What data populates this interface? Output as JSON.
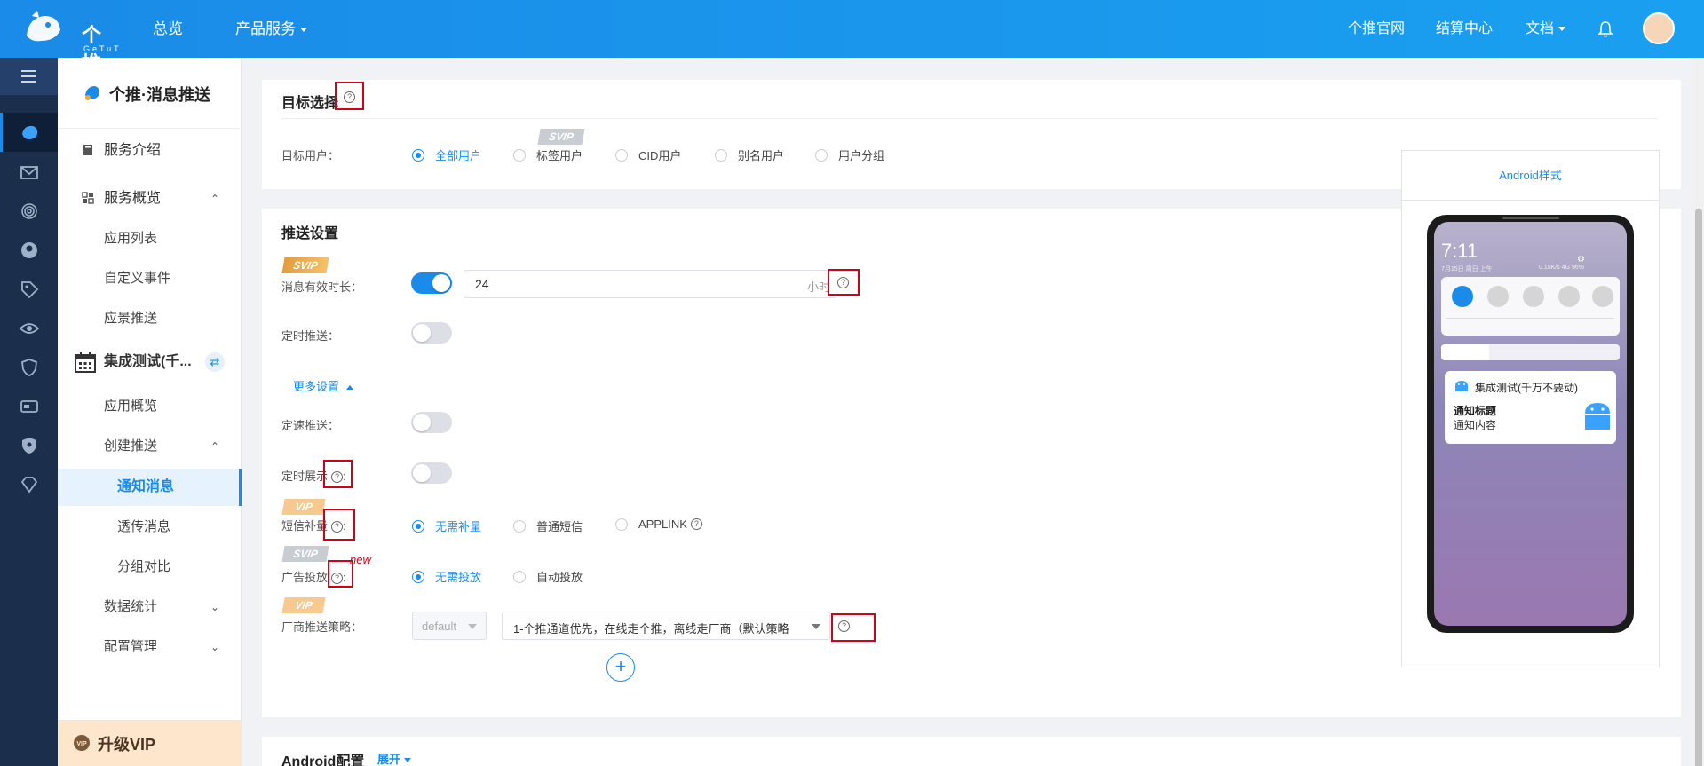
{
  "topbar": {
    "logo_text": "个推",
    "logo_sub": "GeTuT",
    "nav": [
      {
        "label": "总览"
      },
      {
        "label": "产品服务"
      }
    ],
    "right_nav": [
      {
        "label": "个推官网"
      },
      {
        "label": "结算中心"
      },
      {
        "label": "文档"
      }
    ]
  },
  "sidebar": {
    "product_title": "个推·消息推送",
    "items": [
      {
        "label": "服务介绍"
      },
      {
        "label": "服务概览"
      },
      {
        "label": "应用列表"
      },
      {
        "label": "自定义事件"
      },
      {
        "label": "应景推送"
      },
      {
        "label": "集成测试(千..."
      },
      {
        "label": "应用概览"
      },
      {
        "label": "创建推送"
      },
      {
        "label": "通知消息"
      },
      {
        "label": "透传消息"
      },
      {
        "label": "分组对比"
      },
      {
        "label": "数据统计"
      },
      {
        "label": "配置管理"
      }
    ],
    "upgrade_label": "升级VIP"
  },
  "target": {
    "title": "目标选择",
    "user_label": "目标用户：",
    "svip_badge": "SVIP",
    "options": [
      "全部用户",
      "标签用户",
      "CID用户",
      "别名用户",
      "用户分组"
    ],
    "selected": "全部用户"
  },
  "push": {
    "title": "推送设置",
    "svip_badge": "SVIP",
    "vip_badge": "VIP",
    "validity_label": "消息有效时长：",
    "validity_value": "24",
    "validity_unit": "小时",
    "scheduled_label": "定时推送：",
    "more_settings": "更多设置",
    "rate_label": "定速推送：",
    "timed_display_label": "定时展示",
    "sms_label": "短信补量",
    "sms_options": [
      "无需补量",
      "普通短信",
      "APPLINK"
    ],
    "ad_label": "广告投放",
    "ad_new": "new",
    "ad_options": [
      "无需投放",
      "自动投放"
    ],
    "vendor_label": "厂商推送策略：",
    "vendor_default": "default",
    "vendor_strategy": "1-个推通道优先，在线走个推，离线走厂商（默认策略",
    "add_symbol": "+"
  },
  "android_config": {
    "title": "Android配置",
    "expand": "展开"
  },
  "preview": {
    "tab": "Android样式",
    "time": "7:11",
    "date": "7月15日 周日 上午",
    "status": "0.15K/s 4G 96%",
    "notif_app": "集成测试(千万不要动)",
    "notif_title": "通知标题",
    "notif_content": "通知内容"
  },
  "colors": {
    "primary": "#1a8be8",
    "rail": "#1b2f4d",
    "highlight": "#d0021b"
  }
}
